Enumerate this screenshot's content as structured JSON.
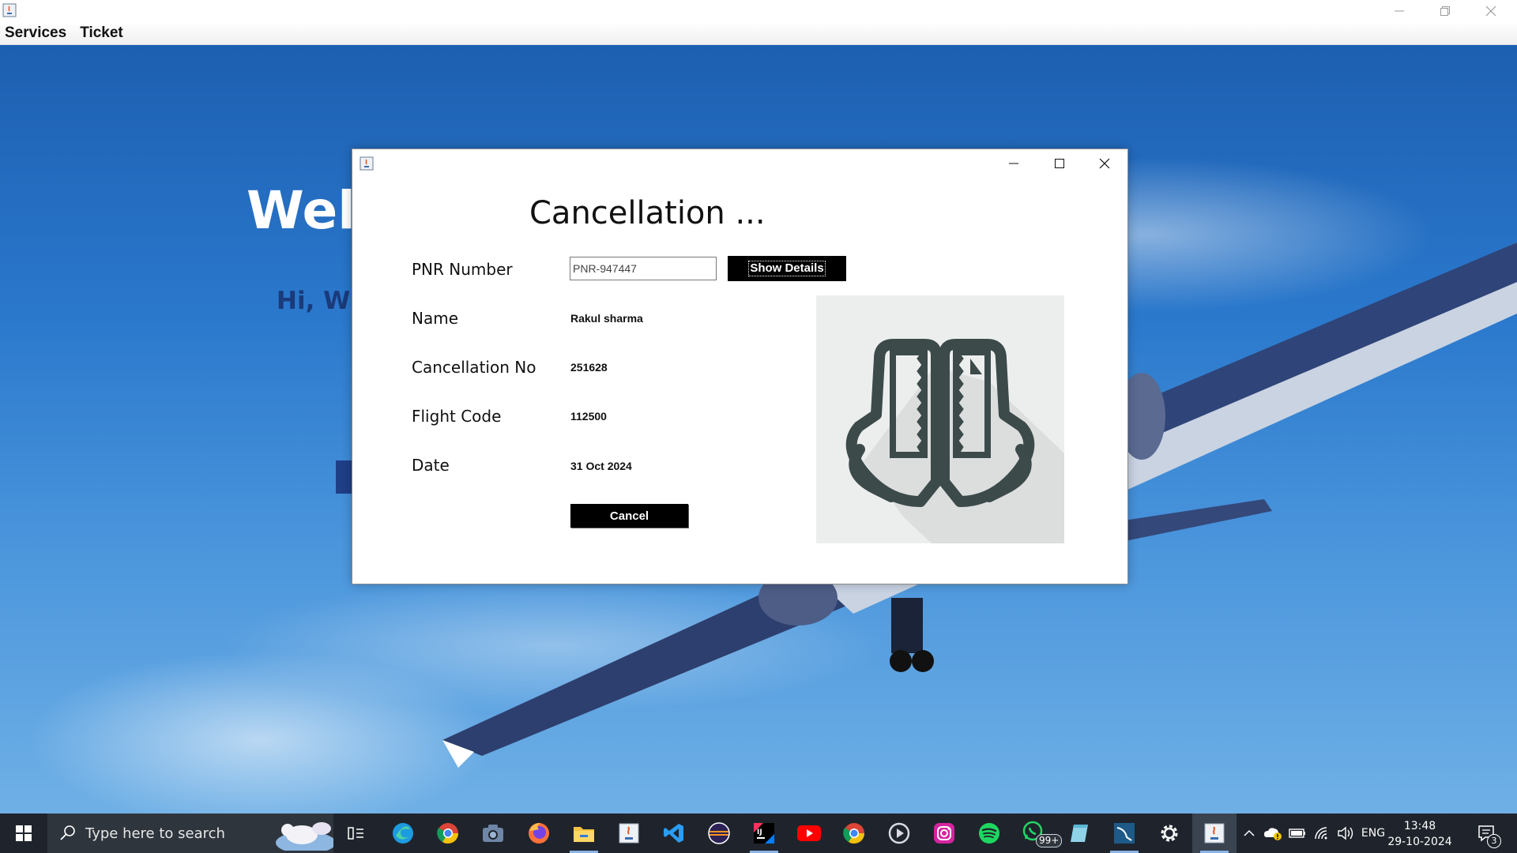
{
  "app": {
    "menus": [
      "Services",
      "Ticket"
    ]
  },
  "background": {
    "welcome_title": "Welc",
    "welcome_subtitle": "Hi, Wh"
  },
  "dialog": {
    "heading": "Cancellation ...",
    "pnr_label": "PNR Number",
    "pnr_value": "PNR-947447",
    "show_details_label": "Show Details",
    "name_label": "Name",
    "name_value": "Rakul sharma",
    "cancellation_no_label": "Cancellation No",
    "cancellation_no_value": "251628",
    "flight_code_label": "Flight Code",
    "flight_code_value": "112500",
    "date_label": "Date",
    "date_value": "31 Oct 2024",
    "cancel_label": "Cancel",
    "image_icon": "torn-ticket-icon"
  },
  "taskbar": {
    "search_placeholder": "Type here to search",
    "apps": [
      "edge",
      "chrome",
      "camera",
      "firefox",
      "file-explorer",
      "java",
      "vscode",
      "eclipse",
      "intellij",
      "youtube",
      "chrome",
      "media-player",
      "instagram",
      "spotify",
      "whatsapp",
      "notepad",
      "mysql-workbench",
      "settings",
      "java-app"
    ],
    "whatsapp_badge": "99+",
    "language": "ENG",
    "time": "13:48",
    "date": "29-10-2024",
    "notification_count": "3"
  },
  "colors": {
    "taskbar": "#1f242c",
    "sky": "#2a78cc",
    "dialog_button": "#000000",
    "welcome_subtitle": "#1a3a7a"
  }
}
